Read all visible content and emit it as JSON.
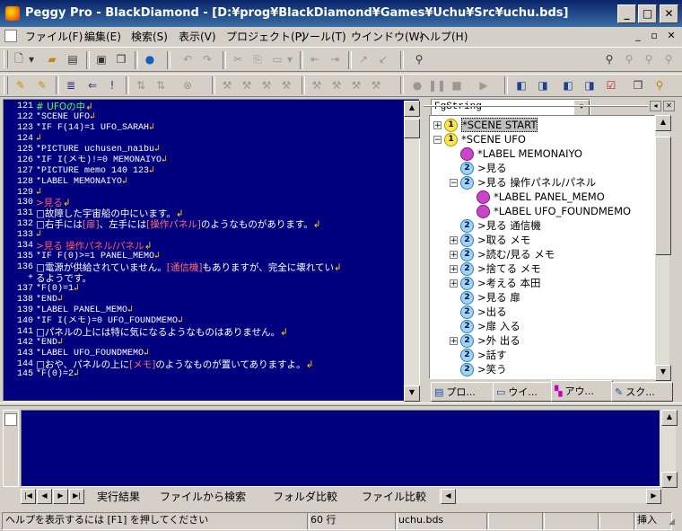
{
  "window": {
    "title": "Peggy Pro - BlackDiamond - [D:¥prog¥BlackDiamond¥Games¥Uchu¥Src¥uchu.bds]",
    "minimize_label": "_",
    "maximize_label": "□",
    "close_label": "✕"
  },
  "menu": {
    "items": [
      "ファイル(F)",
      "編集(E)",
      "検索(S)",
      "表示(V)",
      "プロジェクト(P)",
      "ツール(T)",
      "ウインドウ(W)",
      "ヘルプ(H)"
    ],
    "mdi": [
      "_",
      "▫",
      "✕"
    ]
  },
  "toolbar": {
    "search_value": "FgString"
  },
  "editor": {
    "line_numbers": [
      "121",
      "122",
      "123",
      "124",
      "125",
      "126",
      "127",
      "128",
      "129",
      "130",
      "131",
      "132",
      "133",
      "134",
      "135",
      "136",
      "",
      "137",
      "138",
      "139",
      "140",
      "141",
      "142",
      "143",
      "144",
      "145"
    ],
    "lines": [
      {
        "text": "# UFOの中",
        "kind": "comment"
      },
      {
        "text": "*SCENE UFO",
        "kind": "mono"
      },
      {
        "text": "*IF F(14)=1 UFO_SARAH",
        "kind": "mono"
      },
      {
        "text": "",
        "kind": "mono"
      },
      {
        "text": "*PICTURE uchusen_naibu",
        "kind": "mono"
      },
      {
        "text": "*IF I(メモ)!=0 MEMONAIYO",
        "kind": "mono"
      },
      {
        "text": "*PICTURE memo 140 123",
        "kind": "mono"
      },
      {
        "text": "*LABEL MEMONAIYO",
        "kind": "mono"
      },
      {
        "text": "",
        "kind": "mono"
      },
      {
        "text": ">見る",
        "kind": "label"
      },
      {
        "text": "□故障した宇宙船の中にいます。",
        "kind": "text"
      },
      {
        "text": "□右手には[扉]、左手には[操作パネル]のようなものがあります。",
        "kind": "text"
      },
      {
        "text": "",
        "kind": "mono"
      },
      {
        "text": ">見る 操作パネル/パネル",
        "kind": "label"
      },
      {
        "text": "*IF F(0)>=1 PANEL_MEMO",
        "kind": "mono"
      },
      {
        "text": "□電源が供給されていません。[通信機]もありますが、完全に壊れてい",
        "kind": "text"
      },
      {
        "text": "るようです。",
        "kind": "text"
      },
      {
        "text": "*F(0)=1",
        "kind": "mono"
      },
      {
        "text": "*END",
        "kind": "mono"
      },
      {
        "text": "*LABEL PANEL_MEMO",
        "kind": "mono"
      },
      {
        "text": "*IF I(メモ)=0 UFO_FOUNDMEMO",
        "kind": "mono"
      },
      {
        "text": "□パネルの上には特に気になるようなものはありません。",
        "kind": "text"
      },
      {
        "text": "*END",
        "kind": "mono"
      },
      {
        "text": "*LABEL UFO_FOUNDMEMO",
        "kind": "mono"
      },
      {
        "text": "□おや、パネルの上に[メモ]のようなものが置いてありますよ。",
        "kind": "text"
      },
      {
        "text": "*F(0)=2",
        "kind": "mono"
      }
    ]
  },
  "tree": {
    "nodes": [
      {
        "label": "*SCENE START",
        "icon": "1",
        "depth": 0,
        "exp": "+",
        "selected": true
      },
      {
        "label": "*SCENE UFO",
        "icon": "1",
        "depth": 0,
        "exp": "-"
      },
      {
        "label": "*LABEL MEMONAIYO",
        "icon": "3",
        "depth": 1,
        "exp": ""
      },
      {
        "label": ">見る",
        "icon": "2",
        "depth": 1,
        "exp": ""
      },
      {
        "label": ">見る 操作パネル/パネル",
        "icon": "2",
        "depth": 1,
        "exp": "-"
      },
      {
        "label": "*LABEL PANEL_MEMO",
        "icon": "3",
        "depth": 2,
        "exp": ""
      },
      {
        "label": "*LABEL UFO_FOUNDMEMO",
        "icon": "3",
        "depth": 2,
        "exp": ""
      },
      {
        "label": ">見る 通信機",
        "icon": "2",
        "depth": 1,
        "exp": ""
      },
      {
        "label": ">取る メモ",
        "icon": "2",
        "depth": 1,
        "exp": "+"
      },
      {
        "label": ">読む/見る メモ",
        "icon": "2",
        "depth": 1,
        "exp": "+"
      },
      {
        "label": ">捨てる メモ",
        "icon": "2",
        "depth": 1,
        "exp": "+"
      },
      {
        "label": ">考える 本田",
        "icon": "2",
        "depth": 1,
        "exp": "+"
      },
      {
        "label": ">見る 扉",
        "icon": "2",
        "depth": 1,
        "exp": ""
      },
      {
        "label": ">出る",
        "icon": "2",
        "depth": 1,
        "exp": ""
      },
      {
        "label": ">扉 入る",
        "icon": "2",
        "depth": 1,
        "exp": ""
      },
      {
        "label": ">外 出る",
        "icon": "2",
        "depth": 1,
        "exp": "+"
      },
      {
        "label": ">話す",
        "icon": "2",
        "depth": 1,
        "exp": ""
      },
      {
        "label": ">笑う",
        "icon": "2",
        "depth": 1,
        "exp": ""
      }
    ],
    "tabs": [
      "プロ...",
      "ウイ...",
      "アウ...",
      "スク..."
    ]
  },
  "output": {
    "tabs": [
      "実行結果",
      "ファイルから検索",
      "フォルダ比較",
      "ファイル比較"
    ]
  },
  "status": {
    "help": "ヘルプを表示するには [F1] を押してください",
    "line": "60 行",
    "file": "uchu.bds",
    "mode": "挿入"
  },
  "colors": {
    "editor_bg": "#00007e",
    "title_gradient_start": "#0a246a",
    "label_red": "#ff6060",
    "comment_green": "#5aff5a"
  }
}
